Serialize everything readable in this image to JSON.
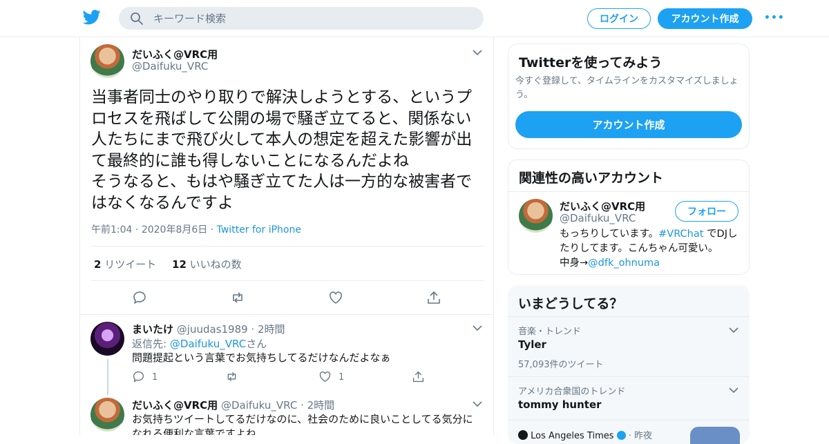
{
  "header": {
    "search_placeholder": "キーワード検索",
    "login_label": "ログイン",
    "signup_label": "アカウント作成",
    "more_label": "•••",
    "brand_color": "#1da1f2"
  },
  "main_tweet": {
    "name": "だいふく@VRC用",
    "handle": "@Daifuku_VRC",
    "text": "当事者同士のやり取りで解決しようとする、というプロセスを飛ばして公開の場で騒ぎ立てると、関係ない人たちにまで飛び火して本人の想定を超えた影響が出て最終的に誰も得しないことになるんだよね\nそうなると、もはや騒ぎ立てた人は一方的な被害者ではなくなるんですよ",
    "time": "午前1:04",
    "date": "2020年8月6日",
    "source": "Twitter for iPhone",
    "retweet_count": "2",
    "retweet_label": "リツイート",
    "like_count": "12",
    "like_label": "いいねの数"
  },
  "replies": [
    {
      "name": "まいたけ",
      "handle": "@juudas1989",
      "time": "2時間",
      "reply_to_label": "返信先:",
      "reply_to_handle": "@Daifuku_VRC",
      "reply_to_suffix": "さん",
      "text": "問題提起という言葉でお気持ちしてるだけなんだよなぁ",
      "reply_count": "1",
      "like_count": "1"
    },
    {
      "name": "だいふく@VRC用",
      "handle": "@Daifuku_VRC",
      "time": "2時間",
      "text": "お気持ちツイートしてるだけなのに、社会のために良いことしてる気分になれる便利な言葉ですよね"
    }
  ],
  "signup_card": {
    "title": "Twitterを使ってみよう",
    "subtitle": "今すぐ登録して、タイムラインをカスタマイズしましょう。",
    "button_label": "アカウント作成"
  },
  "related": {
    "title": "関連性の高いアカウント",
    "name": "だいふく@VRC用",
    "handle": "@Daifuku_VRC",
    "follow_label": "フォロー",
    "bio_1": "もっちりしています。",
    "bio_tag": "#VRChat",
    "bio_2": " でDJしたりしてます。こんちゃん可愛い。　　中身→",
    "bio_mention": "@dfk_ohnuma"
  },
  "trends": {
    "title": "いまどうしてる？",
    "items": [
      {
        "context": "音楽・トレンド",
        "name": "Tyler",
        "count": "57,093件のツイート"
      },
      {
        "context": "アメリカ合衆国のトレンド",
        "name": "tommy hunter"
      }
    ],
    "news_source": "Los Angeles Times",
    "news_time": "昨夜"
  }
}
